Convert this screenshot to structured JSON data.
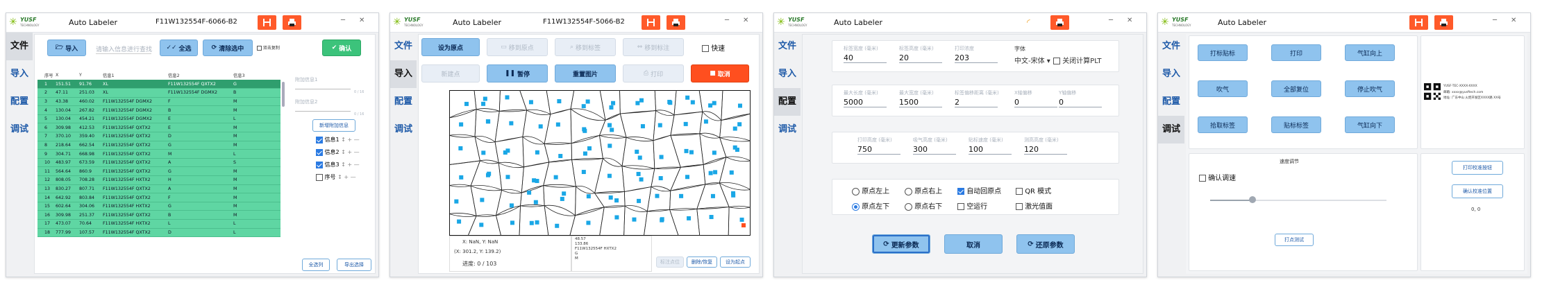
{
  "w1": {
    "title": "Auto Labeler",
    "pn": "F11W132554F-6066-B2",
    "sidebar": [
      "文件",
      "导入",
      "配置",
      "调试"
    ],
    "import": "导入",
    "search_ph": "请输入信息进行查找",
    "select_all": "全选",
    "clear_sel": "清除选中",
    "check_label": "双击复制",
    "confirm": "确认",
    "cols": [
      "序号",
      "X",
      "Y",
      "信息1",
      "信息2",
      "信息3"
    ],
    "rows": [
      [
        "1",
        "151.51",
        "91.76",
        "XL",
        "F11W132554F QXTX2",
        "G"
      ],
      [
        "2",
        "47.11",
        "251.03",
        "XL",
        "F11W132554F DGMX2",
        "B"
      ],
      [
        "3",
        "43.38",
        "460.02",
        "F11W132554F DGMX2",
        "F",
        "M"
      ],
      [
        "4",
        "130.04",
        "267.82",
        "F11W132554F DGMX2",
        "B",
        "M"
      ],
      [
        "5",
        "130.04",
        "454.21",
        "F11W132554F DGMX2",
        "E",
        "L"
      ],
      [
        "6",
        "309.98",
        "412.53",
        "F11W132554F QXTX2",
        "E",
        "M"
      ],
      [
        "7",
        "370.10",
        "359.40",
        "F11W132554F QXTX2",
        "D",
        "M"
      ],
      [
        "8",
        "218.64",
        "662.54",
        "F11W132554F QXTX2",
        "G",
        "M"
      ],
      [
        "9",
        "304.71",
        "668.98",
        "F11W132554F QXTX2",
        "M",
        "L"
      ],
      [
        "10",
        "483.97",
        "673.59",
        "F11W132554F QXTX2",
        "A",
        "S"
      ],
      [
        "11",
        "564.64",
        "860.9",
        "F11W132554F QXTX2",
        "G",
        "M"
      ],
      [
        "12",
        "808.05",
        "708.28",
        "F11W132554F HXTX2",
        "H",
        "M"
      ],
      [
        "13",
        "830.27",
        "807.71",
        "F11W132554F QXTX2",
        "A",
        "M"
      ],
      [
        "14",
        "642.92",
        "803.84",
        "F11W132554F QXTX2",
        "F",
        "M"
      ],
      [
        "15",
        "602.64",
        "304.06",
        "F11W132554F HXTX2",
        "G",
        "M"
      ],
      [
        "16",
        "309.98",
        "251.37",
        "F11W132554F QXTX2",
        "B",
        "M"
      ],
      [
        "17",
        "473.07",
        "70.64",
        "F11W132554F HXTX2",
        "L",
        "L"
      ],
      [
        "18",
        "777.99",
        "107.57",
        "F11W132554F QXTX2",
        "D",
        "L"
      ]
    ],
    "extra1": "附加信息1",
    "extra1_count": "0 / 16",
    "extra2": "附加信息2",
    "extra2_count": "0 / 16",
    "add_info": "新增附加信息",
    "fields": [
      {
        "label": "信息1",
        "on": true
      },
      {
        "label": "信息2",
        "on": true
      },
      {
        "label": "信息3",
        "on": true
      },
      {
        "label": "序号",
        "on": false
      }
    ],
    "all_cols": "全选列",
    "import_sel": "导出选择"
  },
  "w2": {
    "title": "Auto Labeler",
    "pn": "F11W132554F-5066-B2",
    "b_origin": "设为原点",
    "b_dis1": "移到原点",
    "b_dis2": "移到标签",
    "b_dis3": "移到标注",
    "fast": "快速",
    "b_new": "新建点",
    "b_pause": "暂停",
    "b_reset": "重置图片",
    "b_print": "打印",
    "b_cancel": "取消",
    "coords": "X: NaN, Y: NaN",
    "pos": "(X: 301.2, Y: 139.2)",
    "progress": "进度: 0 / 103",
    "info": [
      "48.57",
      "133.86",
      "F11W132554F HXTX2",
      "G",
      "M"
    ],
    "b_p1": "标注点位",
    "b_p2": "删除/恢复",
    "b_p3": "设为起点"
  },
  "w3": {
    "title": "Auto Labeler",
    "g1": [
      {
        "label": "标签宽度 (毫米)",
        "value": "40"
      },
      {
        "label": "标签高度 (毫米)",
        "value": "20"
      },
      {
        "label": "打印浓度",
        "value": "203"
      }
    ],
    "font_label": "字体",
    "font_value": "中文-宋体",
    "plt": "关闭计算PLT",
    "g2": [
      {
        "label": "最大长度 (毫米)",
        "value": "5000"
      },
      {
        "label": "最大宽度 (毫米)",
        "value": "1500"
      },
      {
        "label": "标签偏移距离 (毫米)",
        "value": "2"
      },
      {
        "label": "X轴偏移",
        "value": "0"
      },
      {
        "label": "Y轴偏移",
        "value": "0"
      }
    ],
    "g3": [
      {
        "label": "打印高度 (毫米)",
        "value": "750"
      },
      {
        "label": "吸气高度 (毫米)",
        "value": "300"
      },
      {
        "label": "贴标速度 (毫米)",
        "value": "100"
      },
      {
        "label": "测高高度 (毫米)",
        "value": "120"
      }
    ],
    "r1": "原点左上",
    "r2": "原点右上",
    "c1": "自动回原点",
    "c2": "QR 模式",
    "r3": "原点左下",
    "r4": "原点右下",
    "c3": "空运行",
    "c4": "激光值面",
    "b_update": "更新参数",
    "b_cancel": "取消",
    "b_restore": "还原参数"
  },
  "w4": {
    "title": "Auto Labeler",
    "btns": [
      "打标贴标",
      "打印",
      "气缸向上",
      "吹气",
      "全部复位",
      "停止吹气",
      "拾取标签",
      "贴标标签",
      "气缸向下"
    ],
    "label_lines": [
      "YUSF-TEC-XXXX-XXXX",
      "邮箱: xxxx@yusftech.com",
      "地址: 广东中山 火炬开发区XXXX路 XX号"
    ],
    "speed_title": "速度调节",
    "confirm_speed": "确认调速",
    "b_print_cal": "打印校准按钮",
    "b_confirm_cal": "确认校准位置",
    "cal_value": "0, 0",
    "b_test": "打点测试"
  }
}
